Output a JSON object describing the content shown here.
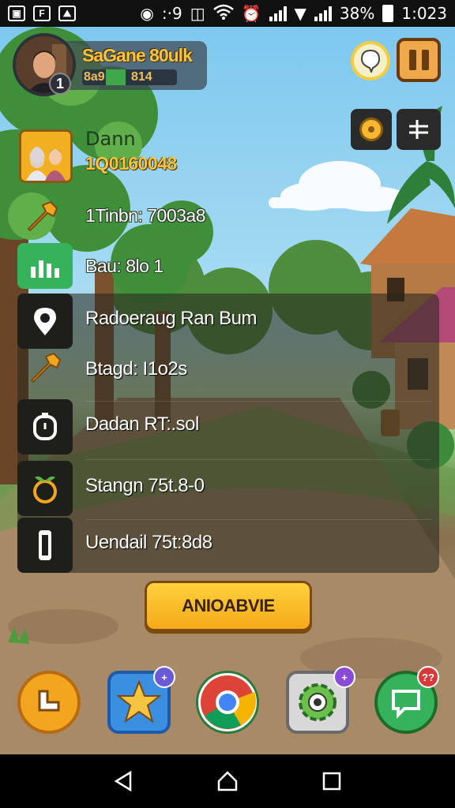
{
  "status_bar": {
    "battery": "38%",
    "time": "1:023",
    "alarm_text": ":·9"
  },
  "header": {
    "player_name": "SaGane 80ulk",
    "xp_left": "8a9",
    "xp_right": "814",
    "xp_progress": 0.42,
    "level": "1"
  },
  "owner": {
    "name": "Dann",
    "id": "1Q0160048"
  },
  "stats": {
    "timer_line": "1Tinbn: 7003a8",
    "badge_line": "Bau: 8lo  1"
  },
  "panel": {
    "rows": [
      {
        "label": "Radoeraug Ran Bum",
        "icon": "location-pin-icon"
      },
      {
        "label": "Btagd: I1o2s",
        "icon": "wrench-icon"
      },
      {
        "label": "Dadan RT:.sol",
        "icon": "clock-icon"
      },
      {
        "label": "Stangn 75t.8-0",
        "icon": "fruit-icon"
      },
      {
        "label": "Uendail 75t:8d8",
        "icon": "phone-icon"
      }
    ]
  },
  "action_button": {
    "label": "ANIOABVIE"
  },
  "dock": {
    "apps": [
      {
        "icon": "messenger-app-icon"
      },
      {
        "icon": "star-app-icon",
        "badge": "+"
      },
      {
        "icon": "chrome-app-icon"
      },
      {
        "icon": "gear-monster-app-icon",
        "badge": "+"
      },
      {
        "icon": "chat-app-icon",
        "badge": "??"
      }
    ]
  },
  "colors": {
    "accent_gold": "#f5c542",
    "button_orange": "#f5a81a",
    "green": "#36b25a"
  }
}
